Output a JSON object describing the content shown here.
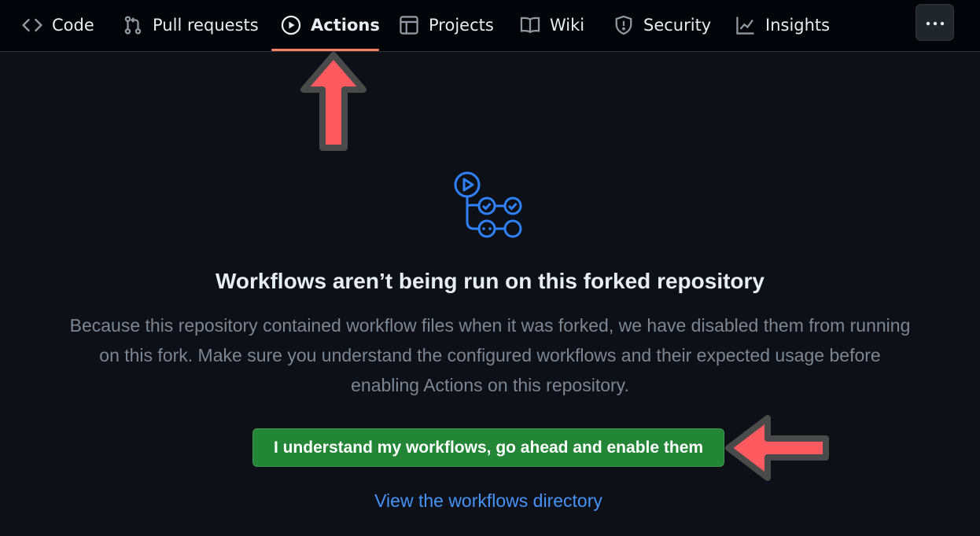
{
  "nav": {
    "tabs": [
      {
        "label": "Code",
        "icon": "code-icon"
      },
      {
        "label": "Pull requests",
        "icon": "git-pull-request-icon"
      },
      {
        "label": "Actions",
        "icon": "play-icon",
        "active": true
      },
      {
        "label": "Projects",
        "icon": "table-icon"
      },
      {
        "label": "Wiki",
        "icon": "book-icon"
      },
      {
        "label": "Security",
        "icon": "shield-icon"
      },
      {
        "label": "Insights",
        "icon": "graph-icon"
      }
    ],
    "more_icon": "kebab-horizontal-icon"
  },
  "main": {
    "icon": "workflow-icon",
    "title": "Workflows aren’t being run on this forked repository",
    "description": "Because this repository contained workflow files when it was forked, we have disabled them from running on this fork. Make sure you understand the configured workflows and their expected usage before enabling Actions on this repository.",
    "enable_button": "I understand my workflows, go ahead and enable them",
    "link": "View the workflows directory"
  },
  "annotations": [
    "arrow-up-icon",
    "arrow-left-icon"
  ],
  "colors": {
    "background": "#0d1117",
    "nav_background": "#010409",
    "text": "#e6edf3",
    "muted": "#7d8590",
    "accent_underline": "#f78166",
    "button_green": "#238636",
    "link": "#4493f8",
    "icon_blue": "#2f81f7",
    "arrow_red": "#ff5a5f"
  }
}
